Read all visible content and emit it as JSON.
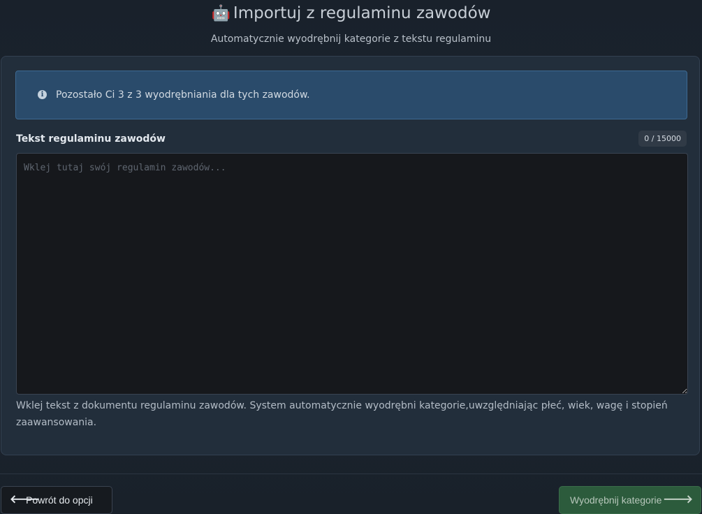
{
  "header": {
    "robot_glyph": "🤖",
    "title": "Importuj z regulaminu zawodów",
    "subtitle": "Automatycznie wyodrębnij kategorie z tekstu regulaminu"
  },
  "alert": {
    "icon": "info-icon",
    "text": "Pozostało Ci 3 z 3 wyodrębniania dla tych zawodów."
  },
  "form": {
    "label": "Tekst regulaminu zawodów",
    "counter": "0 / 15000",
    "value": "",
    "placeholder": "Wklej tutaj swój regulamin zawodów...",
    "help": "Wklej tekst z dokumentu regulaminu zawodów. System automatycznie wyodrębni kategorie,uwzględniając płeć, wiek, wagę i stopień zaawansowania."
  },
  "footer": {
    "back_label": "Powrót do opcji",
    "back_icon": "arrow-left-icon",
    "extract_label": "Wyodrębnij kategorie",
    "extract_icon": "arrow-right-icon"
  },
  "colors": {
    "background": "#1a222c",
    "card": "#222e3b",
    "alert": "#2a4b6b",
    "extract_button": "#2c5b3c"
  }
}
